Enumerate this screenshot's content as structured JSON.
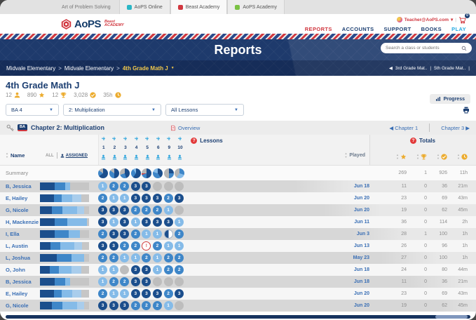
{
  "browser_tabs": {
    "plain_label": "Art of Problem Solving",
    "tabs": [
      {
        "label": "AoPS Online",
        "color": "#29b6c5",
        "active": false
      },
      {
        "label": "Beast Academy",
        "color": "#d1373f",
        "active": true
      },
      {
        "label": "AoPS Academy",
        "color": "#7ac143",
        "active": false
      }
    ]
  },
  "header": {
    "logo": {
      "aops": "AoPS",
      "beast_line1": "Beast",
      "beast_line2": "ACADEMY"
    },
    "account": {
      "email": "Teacher@AoPS.com",
      "caret": "▾",
      "divider": "|",
      "cart_count": "0"
    },
    "nav": [
      {
        "label": "REPORTS",
        "state": "active"
      },
      {
        "label": "ACCOUNTS",
        "state": "normal"
      },
      {
        "label": "SUPPORT",
        "state": "normal"
      },
      {
        "label": "BOOKS",
        "state": "normal"
      },
      {
        "label": "PLAY",
        "state": "play"
      }
    ]
  },
  "banner": {
    "title": "Reports",
    "search_placeholder": "Search a class or students",
    "breadcrumb": [
      "Midvale Elementary",
      "Midvale Elementary"
    ],
    "breadcrumb_sep": ">",
    "breadcrumb_current": "4th Grade Math J",
    "class_nav": {
      "prev_arrow": "◀",
      "item1": "3rd Grade Mat..",
      "divider": "|",
      "item2": "5th Grade Mat..",
      "trailing_divider": "|"
    }
  },
  "page": {
    "title": "4th Grade Math J",
    "stats": {
      "students": "12",
      "stars": "890",
      "trophies": "12",
      "checks": "3,028",
      "time": "35h"
    },
    "progress_label": "Progress",
    "filters": {
      "level": "BA 4",
      "chapter": "2: Multiplication",
      "lessons": "All Lessons"
    }
  },
  "chapter_bar": {
    "badge": "BA",
    "title": "Chapter 2: Multiplication",
    "overview_label": "Overview",
    "prev_arrow": "◀",
    "prev": "Chapter 1",
    "next": "Chapter 3",
    "next_arrow": "▶"
  },
  "table": {
    "name_label": "Name",
    "all_label": "ALL",
    "assigned_label": "ASSIGNED",
    "lessons_label": "Lessons",
    "played_label": "Played",
    "totals_label": "Totals",
    "lesson_numbers": [
      "1",
      "2",
      "3",
      "4",
      "5",
      "6",
      "9",
      "10"
    ],
    "summary_label": "Summary",
    "summary": {
      "pies": [
        [
          [
            "d",
            65
          ],
          [
            "m",
            20
          ],
          [
            "g",
            15
          ]
        ],
        [
          [
            "d",
            50
          ],
          [
            "m",
            35
          ],
          [
            "g",
            15
          ]
        ],
        [
          [
            "d",
            45
          ],
          [
            "m",
            25
          ],
          [
            "g",
            30
          ]
        ],
        [
          [
            "d",
            60
          ],
          [
            "m",
            30
          ],
          [
            "l",
            10
          ]
        ],
        [
          [
            "d",
            50
          ],
          [
            "m",
            20
          ],
          [
            "r",
            5
          ],
          [
            "g",
            25
          ]
        ],
        [
          [
            "d",
            40
          ],
          [
            "m",
            40
          ],
          [
            "l",
            20
          ]
        ],
        [
          [
            "d",
            25
          ],
          [
            "m",
            25
          ],
          [
            "g",
            50
          ]
        ],
        [
          [
            "m",
            30
          ],
          [
            "l",
            30
          ],
          [
            "g",
            40
          ]
        ]
      ],
      "totals": [
        "269",
        "1",
        "926",
        "11h"
      ]
    },
    "rows": [
      {
        "name": "B, Jessica",
        "bar": [
          [
            "3",
            30
          ],
          [
            "2",
            22
          ],
          [
            "1",
            9
          ],
          [
            "g",
            39
          ]
        ],
        "scores": [
          "1",
          "2",
          "2",
          "3",
          "3",
          "0",
          "0",
          "0"
        ],
        "played": "Jun 18",
        "totals": [
          "11",
          "0",
          "36",
          "21m"
        ]
      },
      {
        "name": "E, Hailey",
        "bar": [
          [
            "3",
            28
          ],
          [
            "2",
            16
          ],
          [
            "1",
            22
          ],
          [
            "p",
            18
          ],
          [
            "g",
            16
          ]
        ],
        "scores": [
          "2",
          "1",
          "1",
          "3",
          "3",
          "3",
          "2",
          "3"
        ],
        "played": "Jun 20",
        "totals": [
          "23",
          "0",
          "69",
          "43m"
        ]
      },
      {
        "name": "G, Nicole",
        "bar": [
          [
            "3",
            24
          ],
          [
            "2",
            22
          ],
          [
            "1",
            30
          ],
          [
            "p",
            14
          ],
          [
            "g",
            10
          ]
        ],
        "scores": [
          "3",
          "3",
          "3",
          "2",
          "2",
          "2",
          "1",
          "0"
        ],
        "played": "Jun 20",
        "totals": [
          "19",
          "0",
          "62",
          "45m"
        ]
      },
      {
        "name": "H, Mackenzie",
        "bar": [
          [
            "3",
            30
          ],
          [
            "2",
            26
          ],
          [
            "1",
            40
          ],
          [
            "g",
            4
          ]
        ],
        "scores": [
          "3",
          "1",
          "3",
          "1",
          "3",
          "3",
          "3",
          "1"
        ],
        "played": "Jun 11",
        "totals": [
          "36",
          "0",
          "114",
          "2h"
        ]
      },
      {
        "name": "I, Ella",
        "bar": [
          [
            "3",
            30
          ],
          [
            "2",
            28
          ],
          [
            "1",
            24
          ],
          [
            "g",
            18
          ]
        ],
        "scores": [
          "2",
          "3",
          "3",
          "2",
          "1",
          "1",
          "H",
          "2"
        ],
        "played": "Jun 3",
        "totals": [
          "28",
          "1",
          "100",
          "1h"
        ]
      },
      {
        "name": "L, Austin",
        "bar": [
          [
            "3",
            22
          ],
          [
            "2",
            20
          ],
          [
            "1",
            28
          ],
          [
            "p",
            16
          ],
          [
            "g",
            14
          ]
        ],
        "scores": [
          "3",
          "3",
          "2",
          "2",
          "!",
          "2",
          "1",
          "1"
        ],
        "played": "Jun 13",
        "totals": [
          "26",
          "0",
          "96",
          "1h"
        ]
      },
      {
        "name": "L, Joshua",
        "bar": [
          [
            "3",
            34
          ],
          [
            "2",
            30
          ],
          [
            "1",
            26
          ],
          [
            "g",
            10
          ]
        ],
        "scores": [
          "2",
          "2",
          "1",
          "1",
          "2",
          "1",
          "2",
          "2"
        ],
        "played": "May 23",
        "totals": [
          "27",
          "0",
          "100",
          "1h"
        ]
      },
      {
        "name": "O, John",
        "bar": [
          [
            "3",
            20
          ],
          [
            "2",
            18
          ],
          [
            "1",
            26
          ],
          [
            "p",
            20
          ],
          [
            "g",
            16
          ]
        ],
        "scores": [
          "1",
          "1",
          "0",
          "3",
          "3",
          "1",
          "2",
          "2"
        ],
        "played": "Jun 18",
        "totals": [
          "24",
          "0",
          "80",
          "44m"
        ]
      },
      {
        "name": "B, Jessica",
        "bar": [
          [
            "3",
            30
          ],
          [
            "2",
            22
          ],
          [
            "1",
            9
          ],
          [
            "g",
            39
          ]
        ],
        "scores": [
          "1",
          "2",
          "2",
          "3",
          "3",
          "0",
          "0",
          "0"
        ],
        "played": "Jun 18",
        "totals": [
          "11",
          "0",
          "36",
          "21m"
        ]
      },
      {
        "name": "E, Hailey",
        "bar": [
          [
            "3",
            28
          ],
          [
            "2",
            16
          ],
          [
            "1",
            22
          ],
          [
            "p",
            18
          ],
          [
            "g",
            16
          ]
        ],
        "scores": [
          "2",
          "1",
          "1",
          "3",
          "3",
          "3",
          "2",
          "3"
        ],
        "played": "Jun 20",
        "totals": [
          "23",
          "0",
          "69",
          "43m"
        ]
      },
      {
        "name": "G, Nicole",
        "bar": [
          [
            "3",
            24
          ],
          [
            "2",
            22
          ],
          [
            "1",
            30
          ],
          [
            "p",
            14
          ],
          [
            "g",
            10
          ]
        ],
        "scores": [
          "3",
          "3",
          "3",
          "2",
          "2",
          "2",
          "1",
          "0"
        ],
        "played": "Jun 20",
        "totals": [
          "19",
          "0",
          "62",
          "45m"
        ]
      }
    ]
  },
  "colors": {
    "score3": "#1b4e8c",
    "score2": "#3e86c8",
    "score1": "#85bbe8",
    "score0": "#bdbdbd",
    "bar_pale": "#a9cdec",
    "bar_gray": "#c6c6c6",
    "alert_red": "#d03b3b",
    "accent_red": "#d1373f",
    "navy": "#1c3f72",
    "link_blue": "#3a6fb5",
    "gold": "#ecac2f",
    "play_cyan": "#29abe2"
  }
}
